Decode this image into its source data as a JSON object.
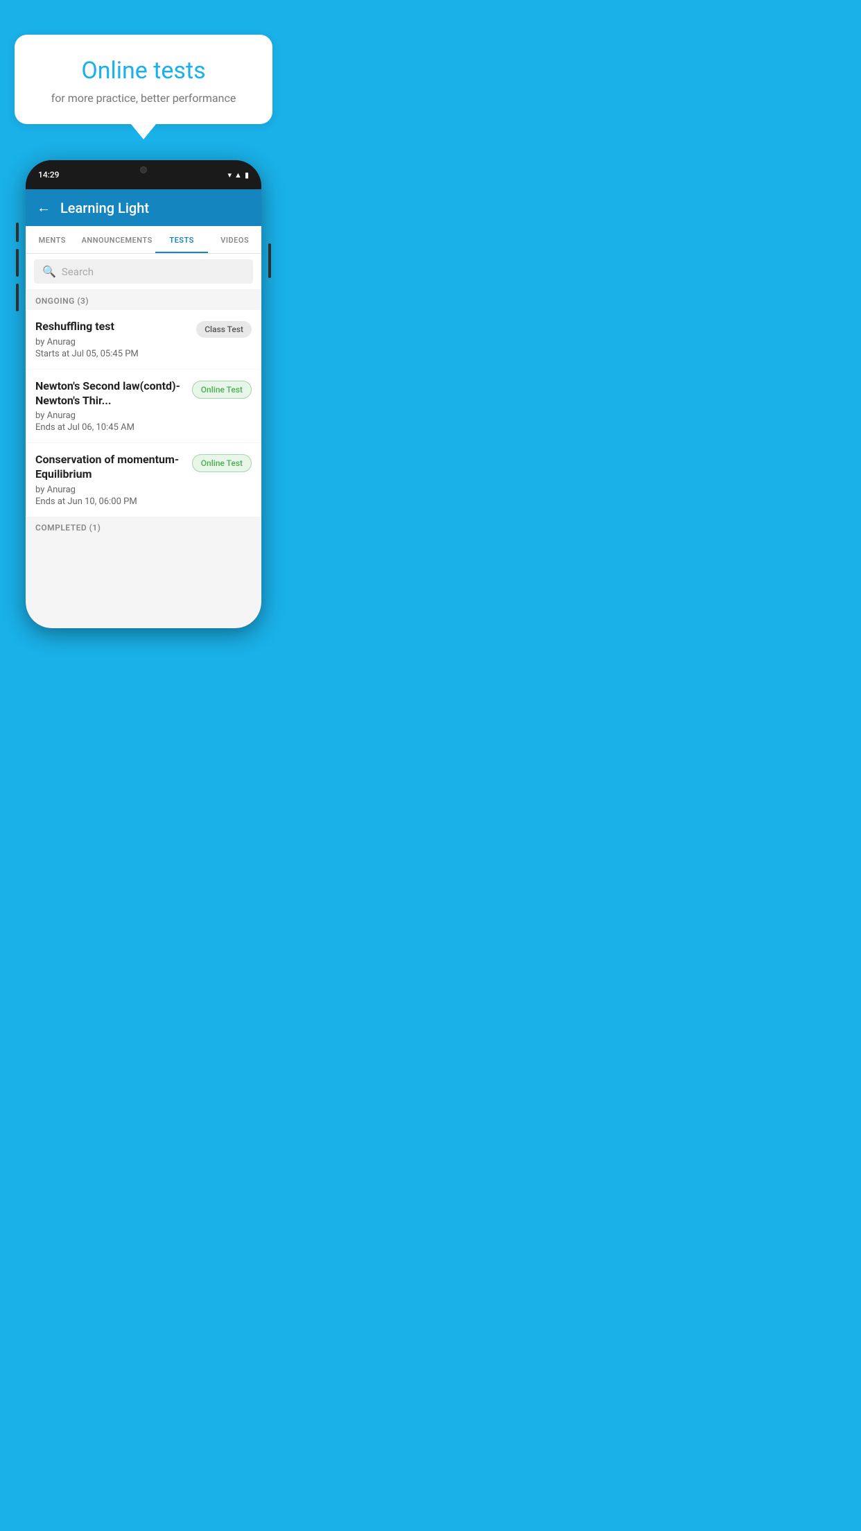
{
  "background_color": "#1ab0e8",
  "speech_bubble": {
    "title": "Online tests",
    "subtitle": "for more practice, better performance"
  },
  "phone": {
    "status_bar": {
      "time": "14:29",
      "icons": [
        "wifi",
        "signal",
        "battery"
      ]
    },
    "header": {
      "back_label": "←",
      "title": "Learning Light"
    },
    "tabs": [
      {
        "label": "MENTS",
        "active": false
      },
      {
        "label": "ANNOUNCEMENTS",
        "active": false
      },
      {
        "label": "TESTS",
        "active": true
      },
      {
        "label": "VIDEOS",
        "active": false
      }
    ],
    "search": {
      "placeholder": "Search"
    },
    "sections": [
      {
        "label": "ONGOING (3)",
        "tests": [
          {
            "name": "Reshuffling test",
            "by": "by Anurag",
            "date": "Starts at  Jul 05, 05:45 PM",
            "badge": "Class Test",
            "badge_type": "class"
          },
          {
            "name": "Newton's Second law(contd)-Newton's Thir...",
            "by": "by Anurag",
            "date": "Ends at  Jul 06, 10:45 AM",
            "badge": "Online Test",
            "badge_type": "online"
          },
          {
            "name": "Conservation of momentum-Equilibrium",
            "by": "by Anurag",
            "date": "Ends at  Jun 10, 06:00 PM",
            "badge": "Online Test",
            "badge_type": "online"
          }
        ]
      }
    ],
    "completed_section_label": "COMPLETED (1)"
  }
}
